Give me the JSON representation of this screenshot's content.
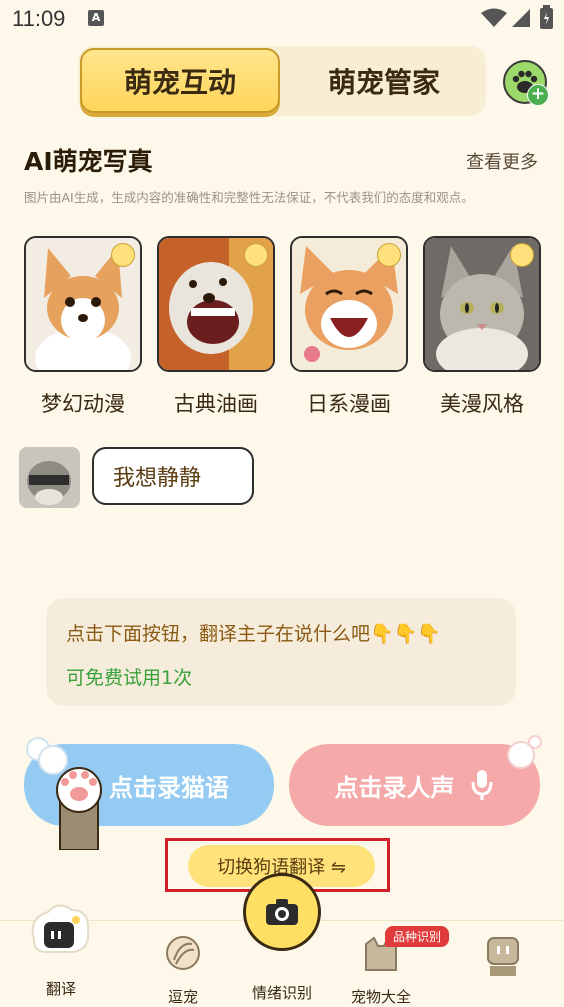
{
  "status": {
    "time": "11:09",
    "notif_icon": "A"
  },
  "tabs": {
    "active": "萌宠互动",
    "inactive": "萌宠管家"
  },
  "section": {
    "title": "AI萌宠写真",
    "see_more": "查看更多",
    "disclaimer": "图片由AI生成，生成内容的准确性和完整性无法保证，不代表我们的态度和观点。"
  },
  "styles": [
    {
      "label": "梦幻动漫",
      "color": "#e6a15c"
    },
    {
      "label": "古典油画",
      "color": "#b55a2a"
    },
    {
      "label": "日系漫画",
      "color": "#e9a060"
    },
    {
      "label": "美漫风格",
      "color": "#8f8f86"
    }
  ],
  "chat": {
    "message": "我想静静"
  },
  "tip": {
    "text": "点击下面按钮，翻译主子在说什么吧👇👇👇",
    "free": "可免费试用1次"
  },
  "record": {
    "cat": "点击录猫语",
    "human": "点击录人声"
  },
  "switch": {
    "label": "切换狗语翻译 ⇋"
  },
  "nav": {
    "items": [
      "翻译",
      "逗宠",
      "情绪识别",
      "宠物大全",
      ""
    ],
    "badge": "品种识别"
  },
  "colors": {
    "accent": "#ffd55a",
    "cat_btn": "#95cbf2",
    "human_btn": "#f5a9a9",
    "free": "#3aa23a"
  }
}
